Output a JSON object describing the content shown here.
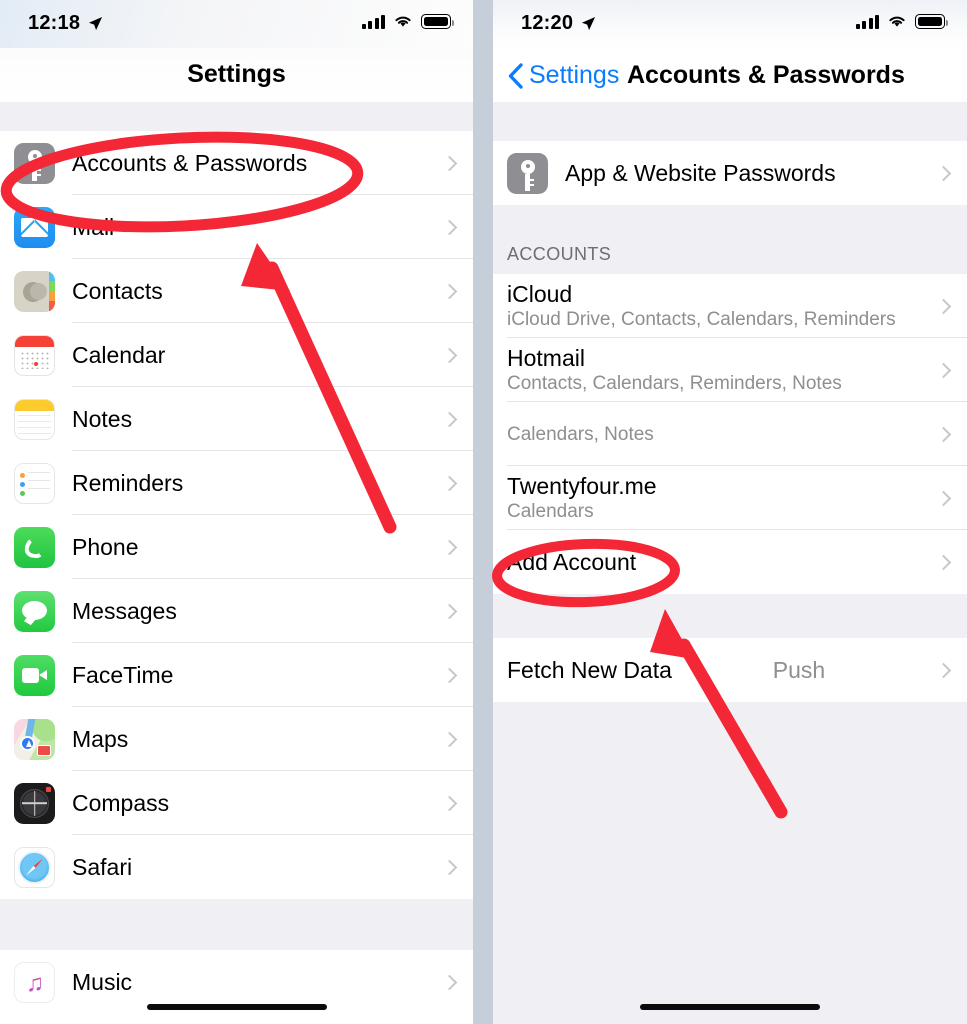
{
  "accent": {
    "red": "#f32735",
    "blue": "#0a7cff",
    "gray_text": "#8e8e93",
    "group_bg": "#efeff4"
  },
  "left_panel": {
    "status": {
      "time": "12:18",
      "location_icon": "location-arrow-icon",
      "signal_icon": "cellular-bars-icon",
      "wifi_icon": "wifi-icon",
      "battery_icon": "battery-full-icon"
    },
    "nav": {
      "title": "Settings"
    },
    "groups": [
      {
        "items": [
          {
            "label": "Accounts & Passwords",
            "icon": "key-icon",
            "icon_key": "key"
          },
          {
            "label": "Mail",
            "icon": "mail-envelope-icon",
            "icon_key": "mail"
          },
          {
            "label": "Contacts",
            "icon": "contacts-icon",
            "icon_key": "contacts"
          },
          {
            "label": "Calendar",
            "icon": "calendar-icon",
            "icon_key": "cal"
          },
          {
            "label": "Notes",
            "icon": "notes-icon",
            "icon_key": "notes"
          },
          {
            "label": "Reminders",
            "icon": "reminders-icon",
            "icon_key": "rem"
          },
          {
            "label": "Phone",
            "icon": "phone-icon",
            "icon_key": "phone"
          },
          {
            "label": "Messages",
            "icon": "messages-icon",
            "icon_key": "msg"
          },
          {
            "label": "FaceTime",
            "icon": "facetime-icon",
            "icon_key": "ft"
          },
          {
            "label": "Maps",
            "icon": "maps-icon",
            "icon_key": "maps"
          },
          {
            "label": "Compass",
            "icon": "compass-icon",
            "icon_key": "comp"
          },
          {
            "label": "Safari",
            "icon": "safari-icon",
            "icon_key": "safari"
          }
        ]
      },
      {
        "items": [
          {
            "label": "Music",
            "icon": "music-icon",
            "icon_key": "music"
          }
        ]
      }
    ]
  },
  "right_panel": {
    "status": {
      "time": "12:20",
      "location_icon": "location-arrow-icon",
      "signal_icon": "cellular-bars-icon",
      "wifi_icon": "wifi-icon",
      "battery_icon": "battery-full-icon"
    },
    "nav": {
      "back_label": "Settings",
      "back_icon": "chevron-left-icon",
      "title": "Accounts & Passwords"
    },
    "passwords_row": {
      "label": "App & Website Passwords",
      "icon": "key-icon"
    },
    "accounts_section_header": "ACCOUNTS",
    "accounts": [
      {
        "title": "iCloud",
        "subtitle": "iCloud Drive, Contacts, Calendars, Reminders"
      },
      {
        "title": "Hotmail",
        "subtitle": "Contacts, Calendars, Reminders, Notes"
      },
      {
        "title": "",
        "subtitle": "Calendars, Notes"
      },
      {
        "title": "Twentyfour.me",
        "subtitle": "Calendars"
      },
      {
        "title": "Add Account",
        "subtitle": ""
      }
    ],
    "fetch_row": {
      "label": "Fetch New Data",
      "value": "Push"
    }
  },
  "annotations": {
    "ellipse_left": {
      "name": "highlight-accounts-passwords",
      "target": "Accounts & Passwords"
    },
    "arrow_left": {
      "name": "pointer-arrow-to-accounts-passwords"
    },
    "ellipse_right": {
      "name": "highlight-add-account",
      "target": "Add Account"
    },
    "arrow_right": {
      "name": "pointer-arrow-to-add-account"
    }
  }
}
